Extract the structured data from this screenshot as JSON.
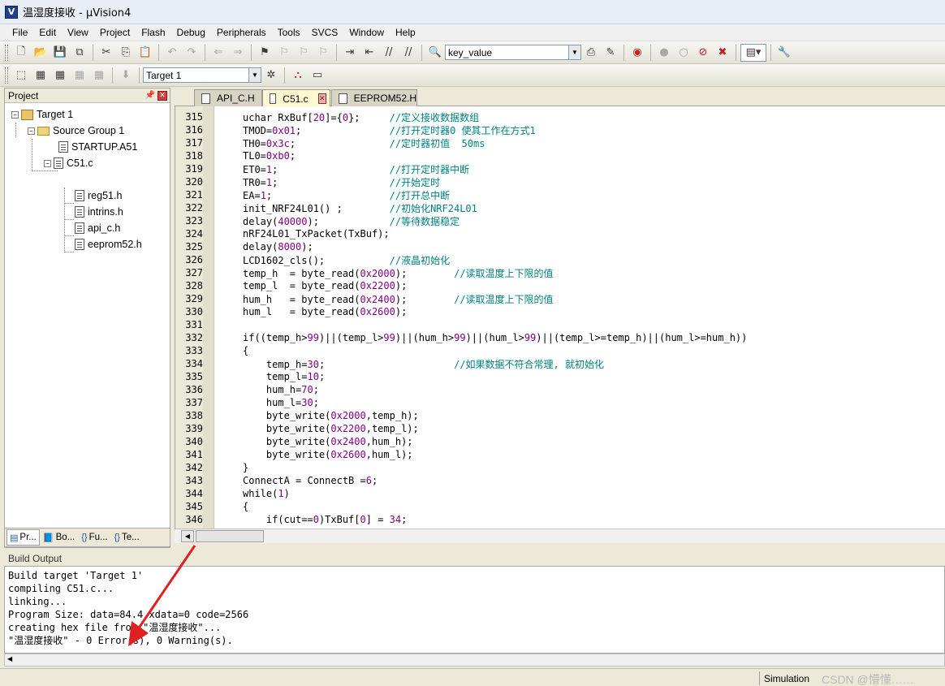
{
  "window": {
    "title": "温湿度接收  - µVision4",
    "icon": "V"
  },
  "menu": [
    "File",
    "Edit",
    "View",
    "Project",
    "Flash",
    "Debug",
    "Peripherals",
    "Tools",
    "SVCS",
    "Window",
    "Help"
  ],
  "toolbar": {
    "find_value": "key_value",
    "target_value": "Target 1"
  },
  "project": {
    "header": "Project",
    "tree": {
      "target": "Target 1",
      "group": "Source Group 1",
      "files": [
        "STARTUP.A51",
        "C51.c"
      ],
      "includes": [
        "reg51.h",
        "intrins.h",
        "api_c.h",
        "eeprom52.h"
      ]
    },
    "tabs": [
      "Pr...",
      "Bo...",
      "Fu...",
      "Te..."
    ]
  },
  "editor": {
    "tabs": [
      "API_C.H",
      "C51.c",
      "EEPROM52.H"
    ],
    "active_tab": "C51.c"
  },
  "code": [
    {
      "ln": "315",
      "text": "uchar RxBuf[20]={0};     //定义接收数据数组"
    },
    {
      "ln": "316",
      "text": "TMOD=0x01;               //打开定时器0 使其工作在方式1"
    },
    {
      "ln": "317",
      "text": "TH0=0x3c;                //定时器初值  50ms"
    },
    {
      "ln": "318",
      "text": "TL0=0xb0;"
    },
    {
      "ln": "319",
      "text": "ET0=1;                   //打开定时器中断"
    },
    {
      "ln": "320",
      "text": "TR0=1;                   //开始定时"
    },
    {
      "ln": "321",
      "text": "EA=1;                    //打开总中断"
    },
    {
      "ln": "322",
      "text": "init_NRF24L01() ;        //初始化NRF24L01"
    },
    {
      "ln": "323",
      "text": "delay(40000);            //等待数据稳定"
    },
    {
      "ln": "324",
      "text": "nRF24L01_TxPacket(TxBuf);"
    },
    {
      "ln": "325",
      "text": "delay(8000);"
    },
    {
      "ln": "326",
      "text": "LCD1602_cls();           //液晶初始化"
    },
    {
      "ln": "327",
      "text": "temp_h  = byte_read(0x2000);        //读取温度上下限的值"
    },
    {
      "ln": "328",
      "text": "temp_l  = byte_read(0x2200);"
    },
    {
      "ln": "329",
      "text": "hum_h   = byte_read(0x2400);        //读取温度上下限的值"
    },
    {
      "ln": "330",
      "text": "hum_l   = byte_read(0x2600);"
    },
    {
      "ln": "331",
      "text": ""
    },
    {
      "ln": "332",
      "text": "if((temp_h>99)||(temp_l>99)||(hum_h>99)||(hum_l>99)||(temp_l>=temp_h)||(hum_l>=hum_h))"
    },
    {
      "ln": "333",
      "text": "{"
    },
    {
      "ln": "334",
      "text": "    temp_h=30;                      //如果数据不符合常理, 就初始化"
    },
    {
      "ln": "335",
      "text": "    temp_l=10;"
    },
    {
      "ln": "336",
      "text": "    hum_h=70;"
    },
    {
      "ln": "337",
      "text": "    hum_l=30;"
    },
    {
      "ln": "338",
      "text": "    byte_write(0x2000,temp_h);"
    },
    {
      "ln": "339",
      "text": "    byte_write(0x2200,temp_l);"
    },
    {
      "ln": "340",
      "text": "    byte_write(0x2400,hum_h);"
    },
    {
      "ln": "341",
      "text": "    byte_write(0x2600,hum_l);"
    },
    {
      "ln": "342",
      "text": "}"
    },
    {
      "ln": "343",
      "text": "ConnectA = ConnectB =6;"
    },
    {
      "ln": "344",
      "text": "while(1)"
    },
    {
      "ln": "345",
      "text": "{"
    },
    {
      "ln": "346",
      "text": "    if(cut==0)TxBuf[0] = 34;"
    }
  ],
  "build": {
    "header": "Build Output",
    "lines": [
      "Build target 'Target 1'",
      "compiling C51.c...",
      "linking...",
      "Program Size: data=84.4 xdata=0 code=2566",
      "creating hex file from \"温湿度接收\"...",
      "\"温湿度接收\" - 0 Error(s), 0 Warning(s)."
    ]
  },
  "status": {
    "mode": "Simulation",
    "watermark": "CSDN @懵懂……"
  },
  "colors": {
    "keyword_num": "#800080",
    "comment": "#008080",
    "arrow": "#e02020"
  }
}
